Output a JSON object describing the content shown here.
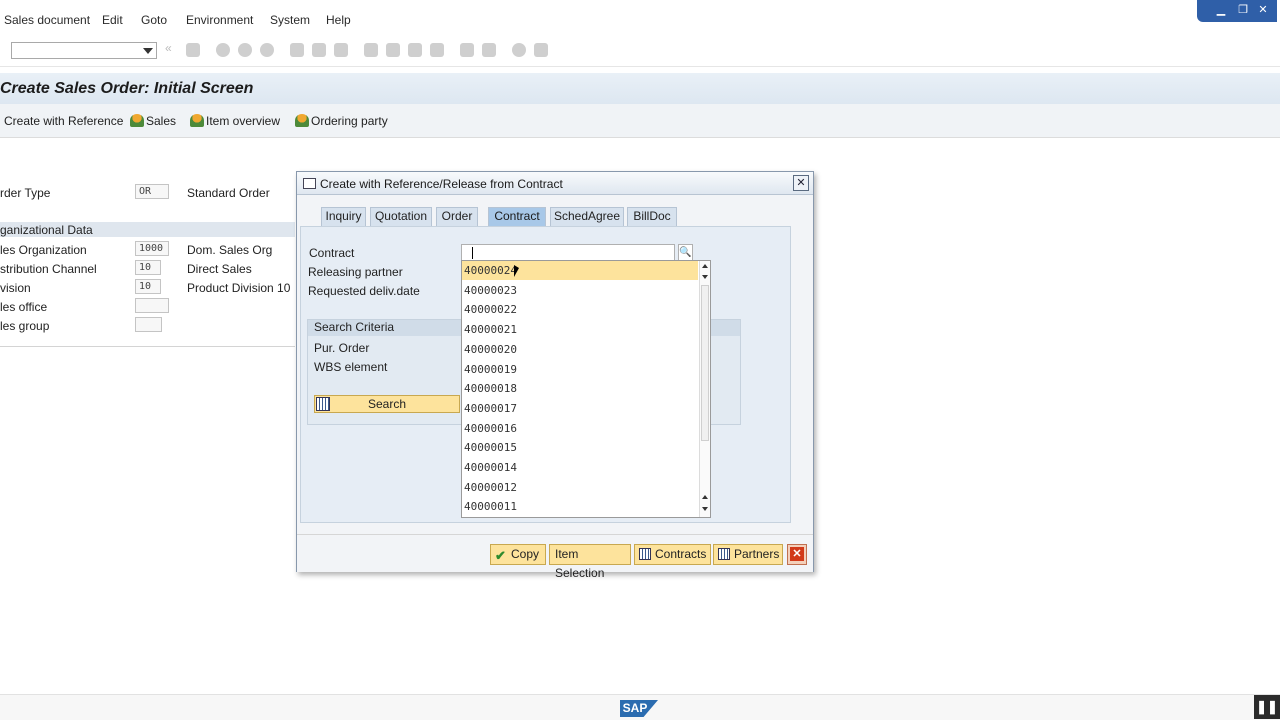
{
  "menu": [
    "Sales document",
    "Edit",
    "Goto",
    "Environment",
    "System",
    "Help"
  ],
  "title": "Create Sales Order: Initial Screen",
  "app_toolbar": {
    "create_with_reference": "Create with Reference",
    "sales": "Sales",
    "item_overview": "Item overview",
    "ordering_party": "Ordering party"
  },
  "form": {
    "order_type_label": "rder Type",
    "order_type_value": "OR",
    "order_type_desc": "Standard Order",
    "org_data_header": "ganizational Data",
    "sales_org_label": "les Organization",
    "sales_org_value": "1000",
    "sales_org_desc": "Dom. Sales Org",
    "dist_channel_label": "stribution Channel",
    "dist_channel_value": "10",
    "dist_channel_desc": "Direct Sales",
    "division_label": "vision",
    "division_value": "10",
    "division_desc": "Product Division 10",
    "sales_office_label": "les office",
    "sales_group_label": "les group"
  },
  "dialog": {
    "title": "Create with Reference/Release from Contract",
    "tabs": [
      "Inquiry",
      "Quotation",
      "Order",
      "Contract",
      "SchedAgree",
      "BillDoc"
    ],
    "active_tab": "Contract",
    "contract_label": "Contract",
    "contract_value": "",
    "releasing_partner_label": "Releasing partner",
    "requested_deliv_label": "Requested deliv.date",
    "search_criteria_label": "Search Criteria",
    "pur_order_label": "Pur. Order",
    "wbs_label": "WBS element",
    "search_button": "Search",
    "dropdown_items": [
      "40000024",
      "40000023",
      "40000022",
      "40000021",
      "40000020",
      "40000019",
      "40000018",
      "40000017",
      "40000016",
      "40000015",
      "40000014",
      "40000012",
      "40000011"
    ],
    "selected_index": 0,
    "buttons": {
      "copy": "Copy",
      "item_selection": "Item Selection",
      "contracts": "Contracts",
      "partners": "Partners"
    }
  },
  "statusbar": {
    "logo": "SAP"
  }
}
